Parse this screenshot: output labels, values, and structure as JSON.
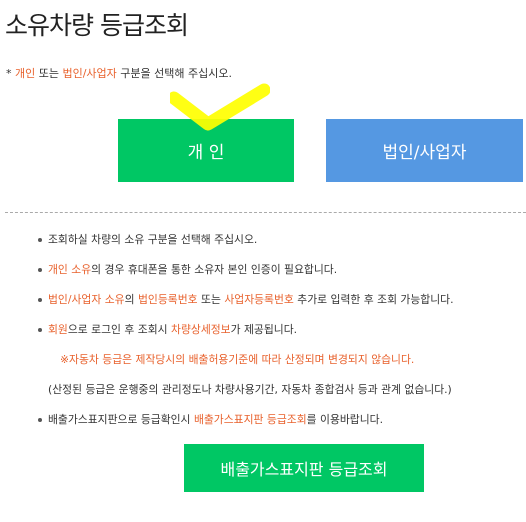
{
  "page_title": "소유차량 등급조회",
  "instruction": {
    "star": "* ",
    "opt1": "개인",
    "mid": " 또는 ",
    "opt2": "법인/사업자",
    "tail": " 구분을 선택해 주십시오."
  },
  "buttons": {
    "personal": "개 인",
    "business": "법인/사업자",
    "emission_lookup": "배출가스표지판 등급조회"
  },
  "notes": {
    "n1": "조회하실 차량의 소유 구분을 선택해 주십시오.",
    "n2_h": "개인 소유",
    "n2_t": "의 경우 휴대폰을 통한 소유자 본인 인증이 필요합니다.",
    "n3_h1": "법인/사업자 소유",
    "n3_t1": "의 ",
    "n3_h2": "법인등록번호",
    "n3_t2": " 또는 ",
    "n3_h3": "사업자등록번호",
    "n3_t3": " 추가로 입력한 후 조회 가능합니다.",
    "n4_h1": "회원",
    "n4_t1": "으로 로그인 후 조회시 ",
    "n4_h2": "차량상세정보",
    "n4_t2": "가 제공됩니다.",
    "warn": "※자동차 등급은 제작당시의 배출허용기준에 따라 산정되며 변경되지 않습니다.",
    "paren": "(산정된 등급은 운행중의 관리정도나 차량사용기간, 자동차 종합검사 등과 관계 없습니다.)",
    "n5_t1": "배출가스표지판으로 등급확인시 ",
    "n5_h": "배출가스표지판 등급조회",
    "n5_t2": "를 이용바랍니다."
  },
  "colors": {
    "highlight": "#e8612c",
    "green": "#00c764",
    "blue": "#5598e2",
    "check_mark": "#ffff00"
  },
  "icons": [
    "check-mark-icon"
  ]
}
